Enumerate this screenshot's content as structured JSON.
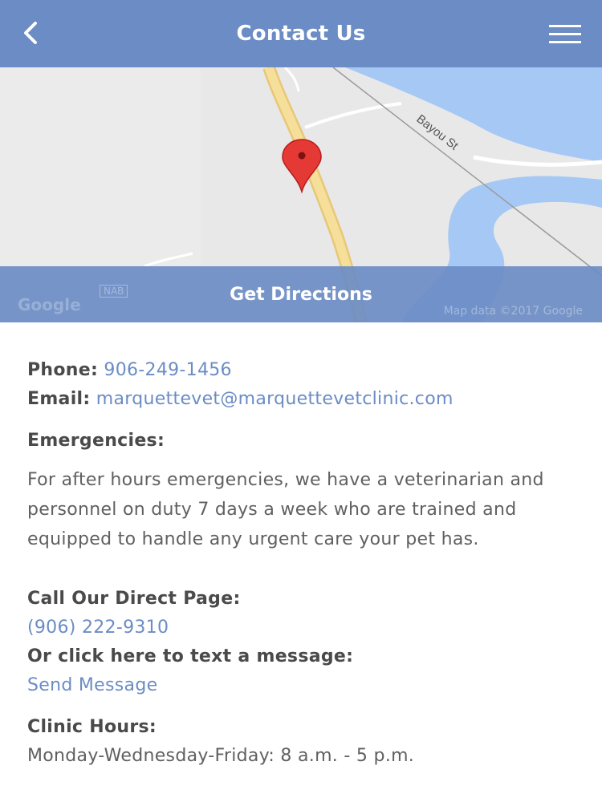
{
  "header": {
    "title": "Contact Us"
  },
  "map": {
    "street_label": "Bayou St",
    "attribution": "Map data ©2017 Google",
    "logo_text": "Google",
    "nab_label": "NAB",
    "directions_button": "Get Directions"
  },
  "contact": {
    "phone_label": "Phone:",
    "phone_value": "906-249-1456",
    "email_label": "Email:",
    "email_value": "marquettevet@marquettevetclinic.com"
  },
  "emergencies": {
    "heading": "Emergencies:",
    "text": "For after hours emergencies, we have a veterinarian and personnel on duty 7 days a week who are trained and equipped to handle any urgent care your pet has."
  },
  "direct_page": {
    "heading": "Call Our Direct Page:",
    "phone": "(906) 222-9310",
    "text_heading": "Or click here to text a message:",
    "send_link": "Send Message"
  },
  "hours": {
    "heading": "Clinic Hours:",
    "line1": "Monday-Wednesday-Friday: 8 a.m. - 5 p.m."
  },
  "colors": {
    "accent": "#6b8cc4",
    "text": "#606060",
    "map_water": "#a6c8f5",
    "map_road": "#f2d88a",
    "pin": "#e53935"
  }
}
